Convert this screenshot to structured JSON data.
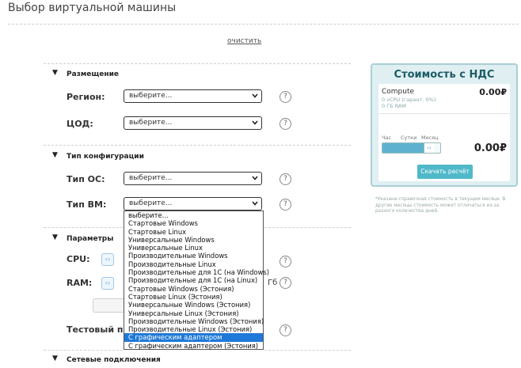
{
  "page": {
    "title": "Выбор виртуальной машины",
    "clear_link": "очистить"
  },
  "placement": {
    "title": "Размещение",
    "region_label": "Регион:",
    "region_value": "выберите...",
    "dc_label": "ЦОД:",
    "dc_value": "выберите..."
  },
  "config": {
    "title": "Тип конфигурации",
    "os_label": "Тип ОС:",
    "os_value": "выберите...",
    "vm_label": "Тип ВМ:",
    "vm_value": "выберите...",
    "vm_options": [
      "выберите...",
      "Стартовые Windows",
      "Стартовые Linux",
      "Универсальные Windows",
      "Универсальные Linux",
      "Производительные Windows",
      "Производительные Linux",
      "Производительные для 1С (на Windows)",
      "Производительные для 1С (на Linux)",
      "Стартовые Windows (Эстония)",
      "Стартовые Linux (Эстония)",
      "Универсальные Windows (Эстония)",
      "Универсальные Linux (Эстония)",
      "Производительные Windows (Эстония)",
      "Производительные Linux (Эстония)",
      "С графическим адаптером",
      "С графическим адаптером (Эстония)"
    ],
    "vm_highlighted_index": 15
  },
  "params": {
    "title": "Параметры",
    "cpu_label": "CPU:",
    "ram_label": "RAM:",
    "ram_unit": "Гб",
    "test_label": "Тестовый пер"
  },
  "network": {
    "title": "Сетевые подключения"
  },
  "price": {
    "title": "Стоимость с НДС",
    "compute_label": "Compute",
    "compute_price": "0.00₽",
    "compute_detail_1": "0 vCPU (гарант. 0%)",
    "compute_detail_2": "0 ГБ RAM",
    "period_hour": "Час",
    "period_day": "Сутки",
    "period_month": "Месяц",
    "period_fraction": 0.85,
    "total": "0.00₽",
    "download_button": "Скачать расчёт",
    "note": "*Указана справочная стоимость в текущем месяце. В другие месяцы стоимость может отличаться из-за разного количества дней."
  },
  "colors": {
    "accent": "#1e79d8",
    "card_bg": "#dfeff2",
    "card_title": "#1d5c66",
    "slider": "#5fb2cf",
    "button": "#4fb9c9"
  }
}
